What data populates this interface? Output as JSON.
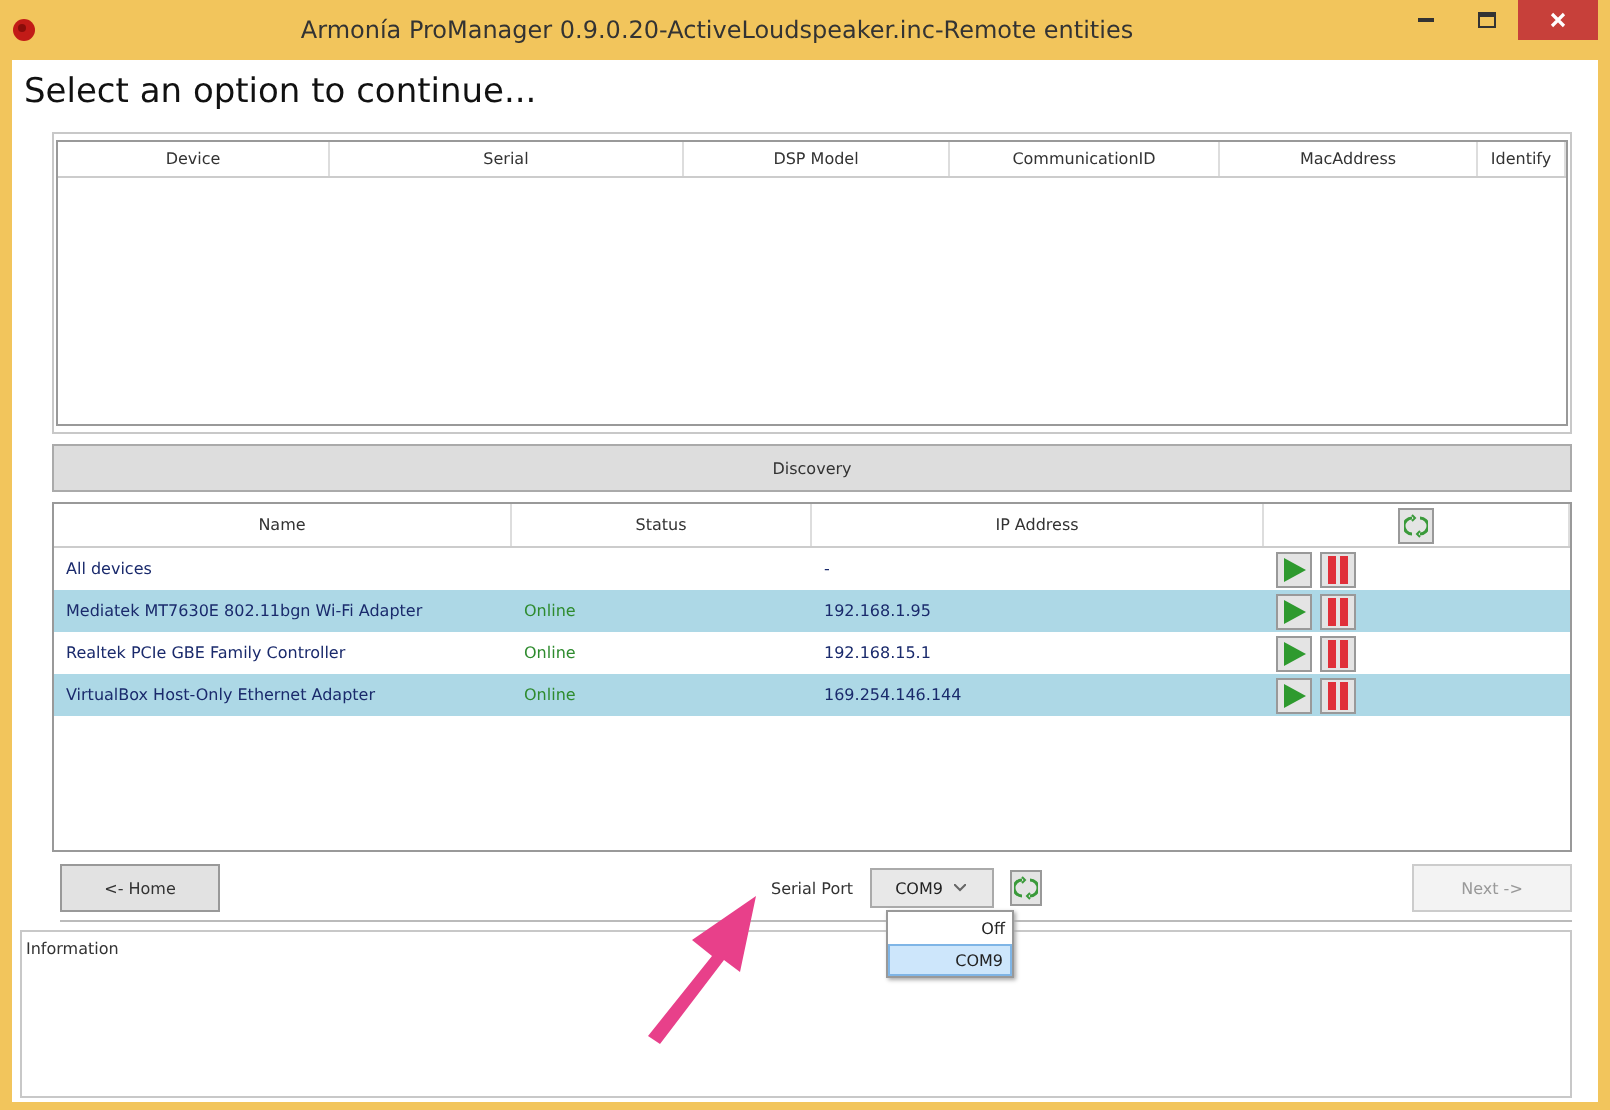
{
  "window": {
    "title": "Armonía ProManager 0.9.0.20-ActiveLoudspeaker.inc-Remote entities"
  },
  "heading": "Select an option to continue...",
  "entities_table": {
    "columns": [
      "Device",
      "Serial",
      "DSP Model",
      "CommunicationID",
      "MacAddress",
      "Identify"
    ]
  },
  "discovery": {
    "title": "Discovery",
    "columns": [
      "Name",
      "Status",
      "IP Address"
    ],
    "rows": [
      {
        "name": "All devices",
        "status": "",
        "ip": "-",
        "selected": false
      },
      {
        "name": "Mediatek MT7630E 802.11bgn Wi-Fi Adapter",
        "status": "Online",
        "ip": "192.168.1.95",
        "selected": true
      },
      {
        "name": "Realtek PCIe GBE Family Controller",
        "status": "Online",
        "ip": "192.168.15.1",
        "selected": false
      },
      {
        "name": "VirtualBox Host-Only Ethernet Adapter",
        "status": "Online",
        "ip": "169.254.146.144",
        "selected": true
      }
    ]
  },
  "footer": {
    "home_button": "<- Home",
    "serial_port_label": "Serial Port",
    "serial_port_value": "COM9",
    "dropdown_open": true,
    "options": [
      {
        "label": "Off",
        "selected": false
      },
      {
        "label": "COM9",
        "selected": true
      }
    ],
    "next_button": {
      "label": "Next ->",
      "disabled": true
    }
  },
  "information": {
    "label": "Information"
  }
}
